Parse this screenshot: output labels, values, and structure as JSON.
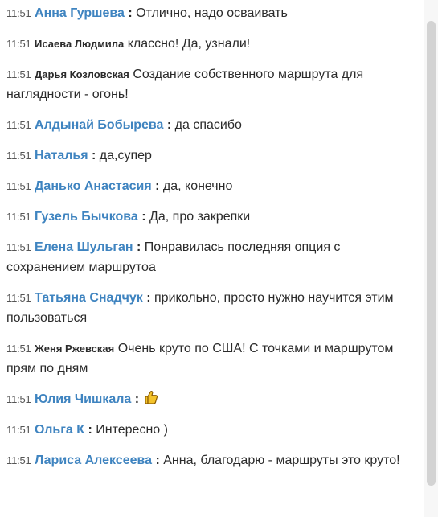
{
  "messages": [
    {
      "time": "11:51",
      "author": "Анна Гуршева",
      "sep": " : ",
      "text": "Отлично, надо осваивать"
    },
    {
      "time": "11:51",
      "author": "Исаева Людмила",
      "sep": " ",
      "text": "классно! Да, узнали!"
    },
    {
      "time": "11:51",
      "author": "Дарья Козловская",
      "sep": " ",
      "text": "Создание собственного маршрута для наглядности - огонь!"
    },
    {
      "time": "11:51",
      "author": "Алдынай Бобырева",
      "sep": " : ",
      "text": "да спасибо"
    },
    {
      "time": "11:51",
      "author": "Наталья",
      "sep": " : ",
      "text": "да,супер"
    },
    {
      "time": "11:51",
      "author": "Данько Анастасия",
      "sep": " : ",
      "text": "да, конечно"
    },
    {
      "time": "11:51",
      "author": "Гузель Бычкова",
      "sep": " : ",
      "text": "Да, про закрепки"
    },
    {
      "time": "11:51",
      "author": "Елена Шульган",
      "sep": " : ",
      "text": "Понравилась последняя опция с сохранением маршрутоа"
    },
    {
      "time": "11:51",
      "author": "Татьяна Снадчук",
      "sep": " : ",
      "text": "прикольно, просто нужно научится этим пользоваться"
    },
    {
      "time": "11:51",
      "author": "Женя Ржевская",
      "sep": " ",
      "text": "Очень круто по США! С точками и маршрутом прям по дням"
    },
    {
      "time": "11:51",
      "author": "Юлия Чишкала",
      "sep": " : ",
      "text": ""
    },
    {
      "time": "11:51",
      "author": "Ольга К",
      "sep": " : ",
      "text": "Интересно )"
    },
    {
      "time": "11:51",
      "author": "Лариса Алексеева",
      "sep": " : ",
      "text": "Анна, благодарю - маршруты это круто!"
    }
  ],
  "icons": {
    "thumbs_up": "thumbs-up-icon"
  },
  "colors": {
    "author_blue": "#3f84c0",
    "text": "#2b2b2b",
    "scroll_thumb": "#d3d3d3"
  }
}
